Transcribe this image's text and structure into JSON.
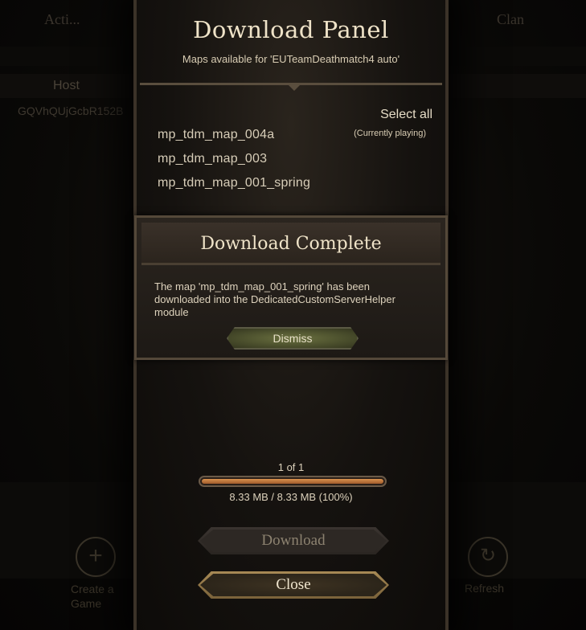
{
  "background": {
    "header_left": "Acti...",
    "header_right": "Clan",
    "host_label": "Host",
    "host_value": "GQVhQUjGcbR152B",
    "create_label": "Create a Game",
    "refresh_label": "Refresh"
  },
  "panel": {
    "title": "Download Panel",
    "subtitle": "Maps available for 'EUTeamDeathmatch4 auto'",
    "select_all": "Select all",
    "current_tag": "(Currently playing)",
    "maps": [
      {
        "name": "mp_tdm_map_004a"
      },
      {
        "name": "mp_tdm_map_003"
      },
      {
        "name": "mp_tdm_map_001_spring"
      }
    ]
  },
  "popup": {
    "title": "Download Complete",
    "body": "The map 'mp_tdm_map_001_spring' has been downloaded into the DedicatedCustomServerHelper module",
    "dismiss_label": "Dismiss"
  },
  "progress": {
    "count": "1 of 1",
    "size": "8.33 MB / 8.33 MB (100%)",
    "fraction": 1.0
  },
  "buttons": {
    "download_label": "Download",
    "close_label": "Close"
  },
  "colors": {
    "accent_gold": "#efe3c8",
    "progress_fill": "#d9924e",
    "dismiss_green": "#6b7140"
  }
}
